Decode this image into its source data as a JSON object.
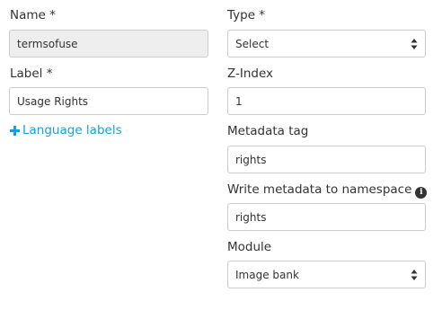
{
  "form": {
    "name": {
      "label": "Name *",
      "value": "termsofuse",
      "disabled": true
    },
    "label": {
      "label": "Label *",
      "value": "Usage Rights"
    },
    "language_labels_link": "Language labels",
    "type": {
      "label": "Type *",
      "selected": "Select"
    },
    "zindex": {
      "label": "Z-Index",
      "value": "1"
    },
    "metadata_tag": {
      "label": "Metadata tag",
      "value": "rights"
    },
    "write_namespace": {
      "label": "Write metadata to namespace",
      "value": "rights",
      "icon": "info-icon"
    },
    "module": {
      "label": "Module",
      "selected": "Image bank"
    }
  },
  "colors": {
    "link": "#1a9fd6",
    "disabled_bg": "#eeeeee",
    "border": "#cccccc"
  }
}
